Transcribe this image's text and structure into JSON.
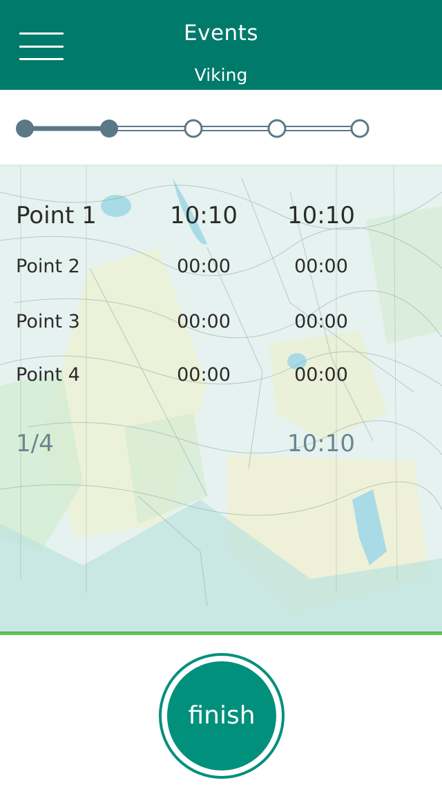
{
  "header": {
    "title": "Events",
    "subtitle": "Viking"
  },
  "stepper": {
    "total_steps": 5,
    "completed_steps": 2
  },
  "points": [
    {
      "name": "Point 1",
      "time_a": "10:10",
      "time_b": "10:10"
    },
    {
      "name": "Point 2",
      "time_a": "00:00",
      "time_b": "00:00"
    },
    {
      "name": "Point 3",
      "time_a": "00:00",
      "time_b": "00:00"
    },
    {
      "name": "Point 4",
      "time_a": "00:00",
      "time_b": "00:00"
    }
  ],
  "summary": {
    "progress": "1/4",
    "total_time": "10:10"
  },
  "finish_label": "finish",
  "colors": {
    "header_bg": "#007a6b",
    "accent": "#00907c",
    "stepper_node": "#5a7886",
    "summary_text": "#6a8691",
    "map_line": "#5cc85a"
  }
}
